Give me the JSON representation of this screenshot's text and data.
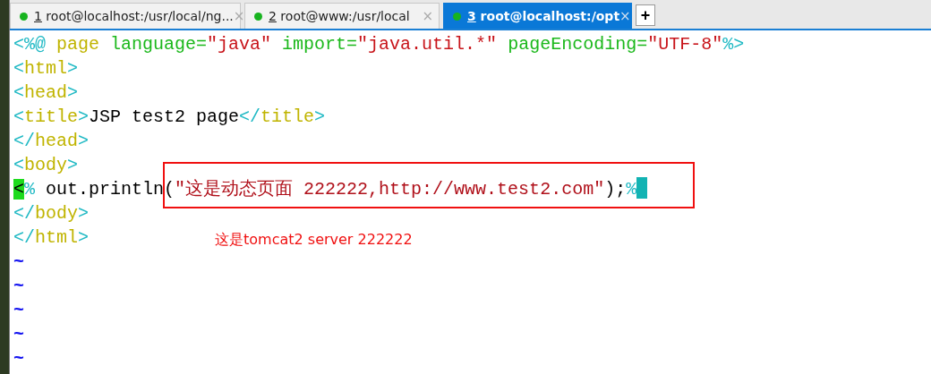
{
  "tabs": [
    {
      "number": "1",
      "label": "root@localhost:/usr/local/ng...",
      "close": "×",
      "selected": false
    },
    {
      "number": "2",
      "label": "root@www:/usr/local",
      "close": "×",
      "selected": false
    },
    {
      "number": "3",
      "label": "root@localhost:/opt",
      "close": "×",
      "selected": true
    }
  ],
  "new_tab": "+",
  "lines": [
    {
      "segments": [
        {
          "kind": "tag",
          "text": "<%@"
        },
        {
          "kind": "keyword",
          "text": " page"
        },
        {
          "kind": "attr",
          "text": " language="
        },
        {
          "kind": "string",
          "text": "\"java\""
        },
        {
          "kind": "attr",
          "text": " import="
        },
        {
          "kind": "string",
          "text": "\"java.util.*\""
        },
        {
          "kind": "attr",
          "text": " pageEncoding="
        },
        {
          "kind": "string",
          "text": "\"UTF-8\""
        },
        {
          "kind": "tag",
          "text": "%>"
        }
      ]
    },
    {
      "segments": [
        {
          "kind": "tag",
          "text": "<"
        },
        {
          "kind": "keyword",
          "text": "html"
        },
        {
          "kind": "tag",
          "text": ">"
        }
      ]
    },
    {
      "segments": [
        {
          "kind": "tag",
          "text": "<"
        },
        {
          "kind": "keyword",
          "text": "head"
        },
        {
          "kind": "tag",
          "text": ">"
        }
      ]
    },
    {
      "segments": [
        {
          "kind": "tag",
          "text": "<"
        },
        {
          "kind": "keyword",
          "text": "title"
        },
        {
          "kind": "tag",
          "text": ">"
        },
        {
          "kind": "plain",
          "text": "JSP test2 page"
        },
        {
          "kind": "tag",
          "text": "</"
        },
        {
          "kind": "keyword",
          "text": "title"
        },
        {
          "kind": "tag",
          "text": ">"
        }
      ]
    },
    {
      "segments": [
        {
          "kind": "tag",
          "text": "</"
        },
        {
          "kind": "keyword",
          "text": "head"
        },
        {
          "kind": "tag",
          "text": ">"
        }
      ]
    },
    {
      "segments": [
        {
          "kind": "tag",
          "text": "<"
        },
        {
          "kind": "keyword",
          "text": "body"
        },
        {
          "kind": "tag",
          "text": ">"
        }
      ]
    },
    {
      "segments": [
        {
          "kind": "match_start",
          "text": "<"
        },
        {
          "kind": "tag",
          "text": "%"
        },
        {
          "kind": "plain",
          "text": " out.println"
        },
        {
          "kind": "plain",
          "text": "("
        },
        {
          "kind": "darkstring",
          "text": "\"这是动态页面 222222,http://www.test2.com\""
        },
        {
          "kind": "plain",
          "text": ");"
        },
        {
          "kind": "tag",
          "text": "%"
        },
        {
          "kind": "match_end"
        }
      ]
    },
    {
      "segments": [
        {
          "kind": "tag",
          "text": "</"
        },
        {
          "kind": "keyword",
          "text": "body"
        },
        {
          "kind": "tag",
          "text": ">"
        }
      ]
    },
    {
      "segments": [
        {
          "kind": "tag",
          "text": "</"
        },
        {
          "kind": "keyword",
          "text": "html"
        },
        {
          "kind": "tag",
          "text": ">"
        }
      ]
    },
    {
      "segments": [
        {
          "kind": "tilde",
          "text": "~"
        }
      ]
    },
    {
      "segments": [
        {
          "kind": "tilde",
          "text": "~"
        }
      ]
    },
    {
      "segments": [
        {
          "kind": "tilde",
          "text": "~"
        }
      ]
    },
    {
      "segments": [
        {
          "kind": "tilde",
          "text": "~"
        }
      ]
    },
    {
      "segments": [
        {
          "kind": "tilde",
          "text": "~"
        }
      ]
    }
  ],
  "annotation": {
    "text": "这是tomcat2 server 222222"
  }
}
